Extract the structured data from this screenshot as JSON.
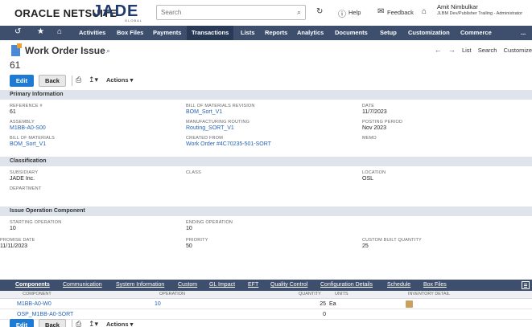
{
  "topbar": {
    "brand": "ORACLE NETSUITE",
    "company_logo": "JADE",
    "company_logo_sub": "GLOBAL",
    "search_placeholder": "Search",
    "help_label": "Help",
    "feedback_label": "Feedback",
    "user_name": "Amit Nimbulkar",
    "user_role": "JLBM Dev/Publisher Trailing - Administrator"
  },
  "nav": {
    "items": [
      "Activities",
      "Box Files",
      "Payments",
      "Transactions",
      "Lists",
      "Reports",
      "Analytics",
      "Documents",
      "Setup",
      "Customization",
      "Commerce",
      "..."
    ],
    "active": "Transactions"
  },
  "header": {
    "title": "Work Order Issue",
    "record_number": "61",
    "right_links": [
      "List",
      "Search",
      "Customize"
    ]
  },
  "buttons": {
    "edit": "Edit",
    "back": "Back",
    "actions": "Actions"
  },
  "primary": {
    "section_title": "Primary Information",
    "reference_label": "REFERENCE #",
    "reference_value": "61",
    "assembly_label": "ASSEMBLY",
    "assembly_value": "M1BB-A0-S00",
    "bom_label": "BILL OF MATERIALS",
    "bom_value": "BOM_Sort_V1",
    "bom_rev_label": "BILL OF MATERIALS REVISION",
    "bom_rev_value": "BOM_Sort_V1",
    "routing_label": "MANUFACTURING ROUTING",
    "routing_value": "Routing_SORT_V1",
    "created_from_label": "CREATED FROM",
    "created_from_value": "Work Order #4C70235-501-SORT",
    "date_label": "DATE",
    "date_value": "11/7/2023",
    "posting_period_label": "POSTING PERIOD",
    "posting_period_value": "Nov 2023",
    "memo_label": "MEMO"
  },
  "classification": {
    "section_title": "Classification",
    "subsidiary_label": "SUBSIDIARY",
    "subsidiary_value": "JADE Inc.",
    "department_label": "DEPARTMENT",
    "class_label": "CLASS",
    "location_label": "LOCATION",
    "location_value": "OSL"
  },
  "operation": {
    "section_title": "Issue Operation Component",
    "starting_label": "STARTING OPERATION",
    "starting_value": "10",
    "ending_label": "ENDING OPERATION",
    "ending_value": "10",
    "promise_label": "PROMISE DATE",
    "promise_value": "11/11/2023",
    "priority_label": "PRIORITY",
    "priority_value": "50",
    "custom_qty_label": "CUSTOM BUILT QUANTITY",
    "custom_qty_value": "25"
  },
  "subtabs": [
    "Components",
    "Communication",
    "System Information",
    "Custom",
    "GL Impact",
    "EFT",
    "Quality Control",
    "Configuration Details",
    "Schedule",
    "Box Files"
  ],
  "grid": {
    "headers": [
      "COMPONENT",
      "OPERATION",
      "QUANTITY",
      "UNITS",
      "INVENTORY DETAIL"
    ],
    "rows": [
      {
        "component": "M1BB-A0-W0",
        "operation": "10",
        "quantity": "25",
        "units": "Ea"
      },
      {
        "component": "OSP_M1BB-A0-SORT",
        "operation": "",
        "quantity": "0",
        "units": ""
      }
    ]
  },
  "icons": {
    "nav": [
      "history-icon",
      "star-icon",
      "home-icon"
    ],
    "print": "print-icon",
    "export": "export-icon"
  },
  "colors": {
    "nav_bg": "#3e4f6e",
    "nav_active": "#293a57",
    "edit_button": "#1f7ad4",
    "link": "#2563b4",
    "section_bg": "#dfe4ec"
  }
}
